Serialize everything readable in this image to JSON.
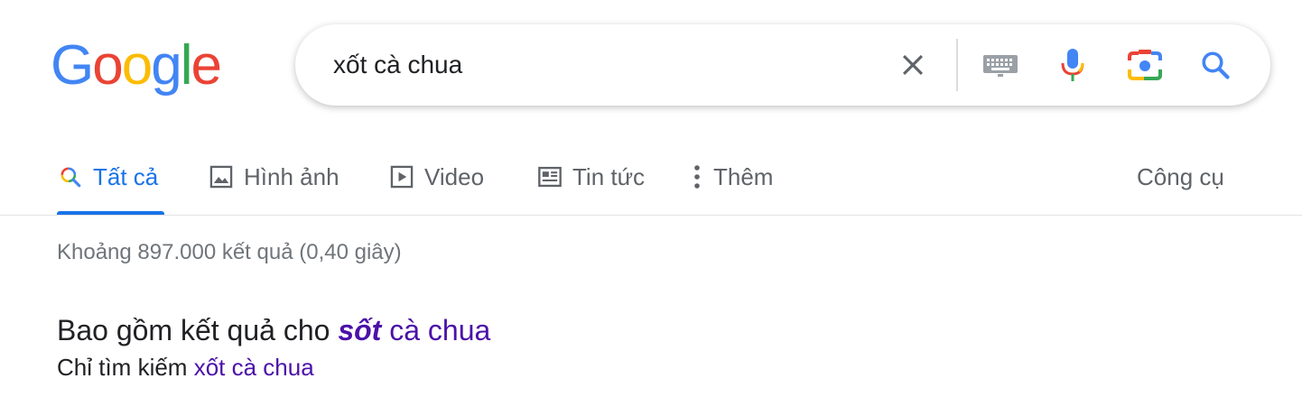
{
  "logo": {
    "letters": [
      {
        "ch": "G",
        "color": "#4285f4"
      },
      {
        "ch": "o",
        "color": "#ea4335"
      },
      {
        "ch": "o",
        "color": "#fbbc05"
      },
      {
        "ch": "g",
        "color": "#4285f4"
      },
      {
        "ch": "l",
        "color": "#34a853"
      },
      {
        "ch": "e",
        "color": "#ea4335"
      }
    ]
  },
  "search": {
    "query": "xốt cà chua",
    "icons": [
      "clear-icon",
      "keyboard-icon",
      "microphone-icon",
      "camera-lens-icon",
      "search-icon"
    ]
  },
  "tabs": [
    {
      "label": "Tất cả",
      "icon": "search-icon",
      "active": true
    },
    {
      "label": "Hình ảnh",
      "icon": "image-icon"
    },
    {
      "label": "Video",
      "icon": "video-icon"
    },
    {
      "label": "Tin tức",
      "icon": "news-icon"
    },
    {
      "label": "Thêm",
      "icon": "more-vert-icon"
    }
  ],
  "tools_label": "Công cụ",
  "result_stats": "Khoảng 897.000 kết quả (0,40 giây)",
  "correction": {
    "prefix": "Bao gồm kết quả cho ",
    "corrected_word": "sốt",
    "rest": " cà chua",
    "instead_prefix": "Chỉ tìm kiếm ",
    "instead_query": "xốt cà chua"
  },
  "colors": {
    "accent": "#1a73e8",
    "visited_link": "#4b11a8"
  }
}
